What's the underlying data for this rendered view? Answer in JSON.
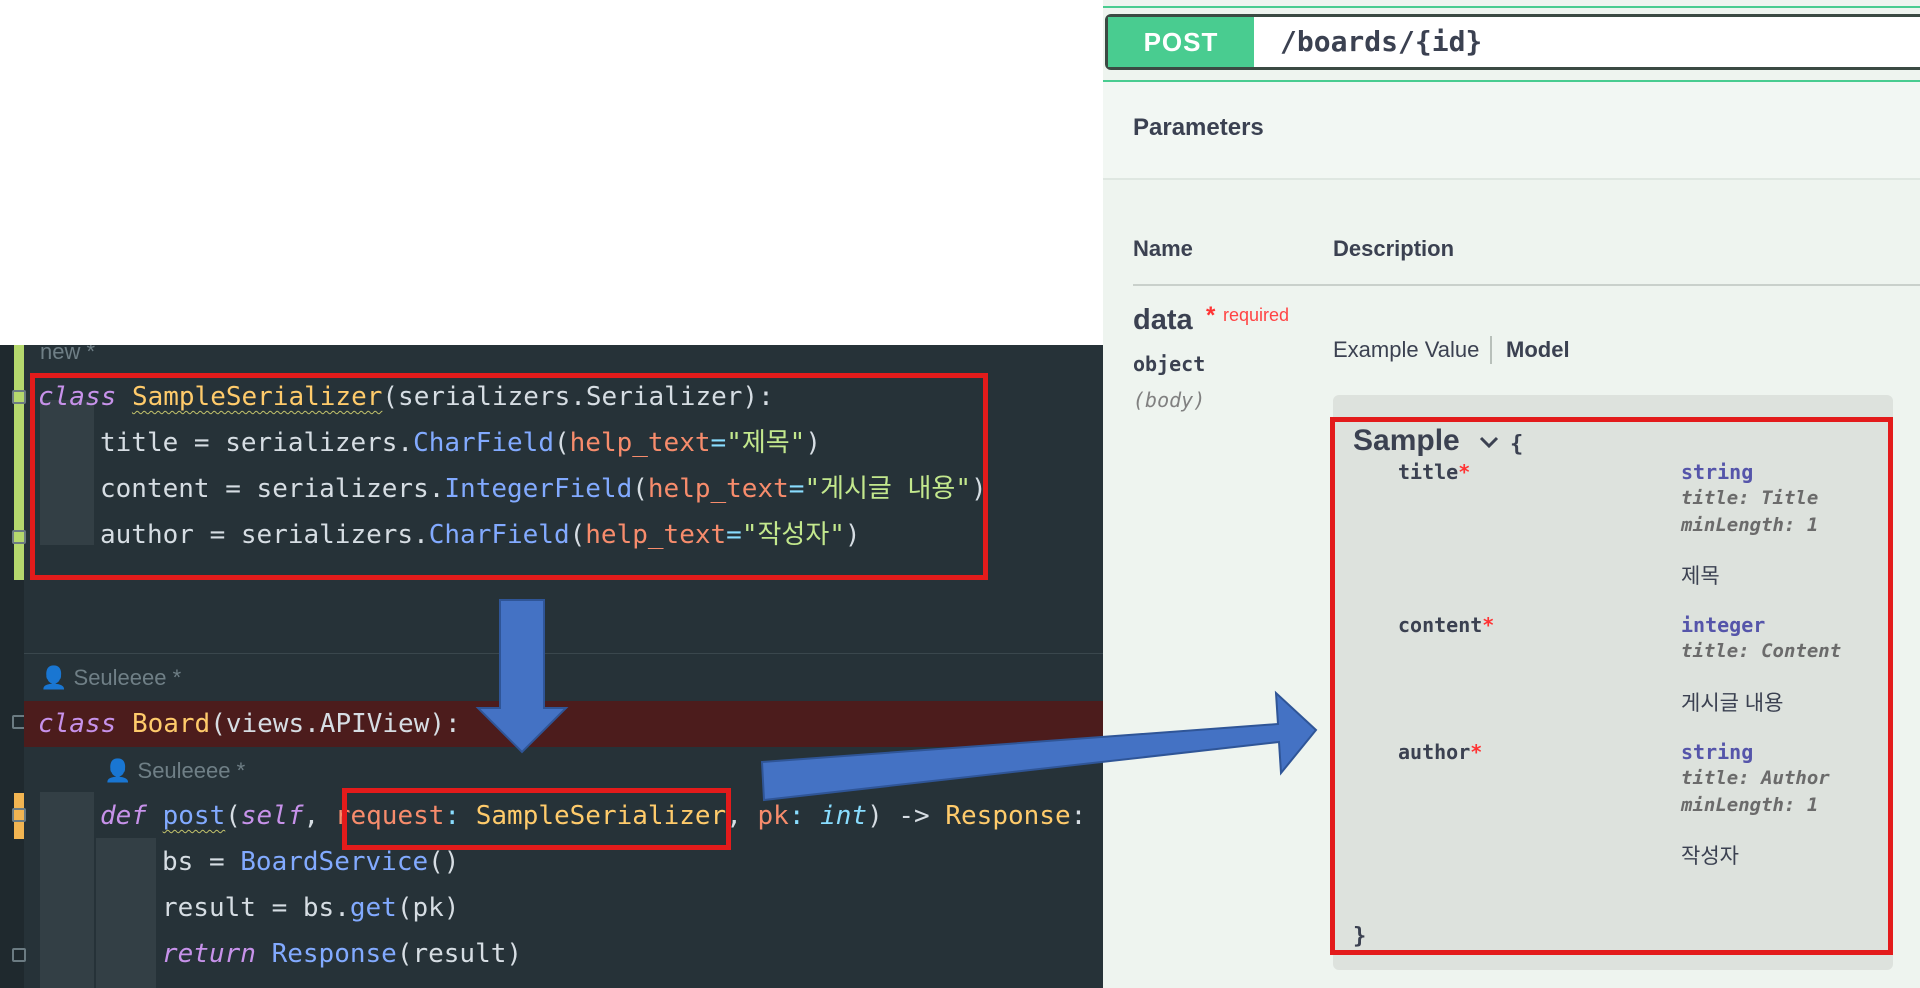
{
  "editor": {
    "top_hint": "new *",
    "author_hint_1": "Seuleeee *",
    "author_hint_2": "Seuleeee *",
    "lines": {
      "l1": {
        "kw": "class",
        "name": "SampleSerializer",
        "rest": "(serializers.Serializer):"
      },
      "l2": {
        "var": "title",
        "eq": " = serializers.",
        "fn": "CharField",
        "open": "(",
        "param": "help_text",
        "assign": "=",
        "str": "\"제목\"",
        "close": ")"
      },
      "l3": {
        "var": "content",
        "eq": " = serializers.",
        "fn": "IntegerField",
        "open": "(",
        "param": "help_text",
        "assign": "=",
        "str": "\"게시글 내용\"",
        "close": ")"
      },
      "l4": {
        "var": "author",
        "eq": " = serializers.",
        "fn": "CharField",
        "open": "(",
        "param": "help_text",
        "assign": "=",
        "str": "\"작성자\"",
        "close": ")"
      },
      "l5": {
        "kw": "class",
        "name": "Board",
        "rest": "(views.APIView):"
      },
      "l6": {
        "kw": "def",
        "fn": "post",
        "open": "(",
        "self": "self",
        "comma1": ", ",
        "p1": "request",
        "colon1": ": ",
        "t1": "SampleSerializer",
        "comma2": ", ",
        "p2": "pk",
        "colon2": ": ",
        "t2": "int",
        "close": ") ",
        "arrow": "->",
        "ret": " Response",
        "end": ":"
      },
      "l7": {
        "var": "bs",
        "eq": " = ",
        "fn": "BoardService",
        "call": "()"
      },
      "l8": {
        "var": "result",
        "eq": " = bs.",
        "fn": "get",
        "call": "(pk)"
      },
      "l9": {
        "kw": "return",
        "sp": " ",
        "fn": "Response",
        "call": "(result)"
      }
    }
  },
  "swagger": {
    "method": "POST",
    "path": "/boards/{id}",
    "parameters_title": "Parameters",
    "columns": {
      "name": "Name",
      "description": "Description"
    },
    "param": {
      "name": "data",
      "star": "*",
      "required": "required",
      "type": "object",
      "in": "(body)"
    },
    "tabs": {
      "example": "Example Value",
      "model": "Model"
    },
    "model": {
      "name": "Sample",
      "open_brace": "{",
      "close_brace": "}",
      "properties": [
        {
          "name": "title",
          "star": "*",
          "type": "string",
          "meta1": "title: Title",
          "meta2": "minLength: 1",
          "description": "제목"
        },
        {
          "name": "content",
          "star": "*",
          "type": "integer",
          "meta1": "title: Content",
          "meta2": "",
          "description": "게시글 내용"
        },
        {
          "name": "author",
          "star": "*",
          "type": "string",
          "meta1": "title: Author",
          "meta2": "minLength: 1",
          "description": "작성자"
        }
      ]
    }
  },
  "colors": {
    "highlight": "#e31b1b",
    "arrow": "#4472c4",
    "post": "#49cc90"
  }
}
